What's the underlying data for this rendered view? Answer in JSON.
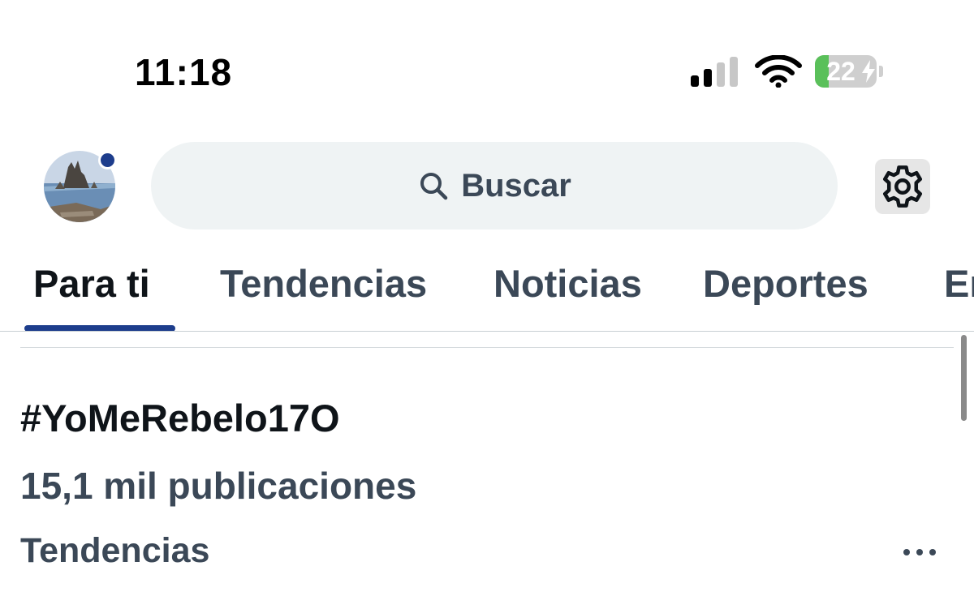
{
  "status_bar": {
    "time": "11:18",
    "battery_percent": "22",
    "battery_level": 0.22,
    "signal_bars_active": 2,
    "signal_bars_total": 4,
    "battery_charging": true,
    "battery_color": "#5ac05a"
  },
  "header": {
    "avatar_icon": "profile-avatar",
    "notification_dot_color": "#1d3d8c",
    "search": {
      "label": "Buscar",
      "icon": "search-icon"
    },
    "settings_icon": "gear-icon"
  },
  "tabs": [
    {
      "label": "Para ti",
      "active": true
    },
    {
      "label": "Tendencias",
      "active": false
    },
    {
      "label": "Noticias",
      "active": false
    },
    {
      "label": "Deportes",
      "active": false
    },
    {
      "label": "En",
      "active": false
    }
  ],
  "accent_color": "#1d3d8c",
  "trend": {
    "title": "#YoMeRebelo17O",
    "count": "15,1 mil publicaciones",
    "category": "Tendencias",
    "more_icon": "more-horizontal-icon"
  }
}
